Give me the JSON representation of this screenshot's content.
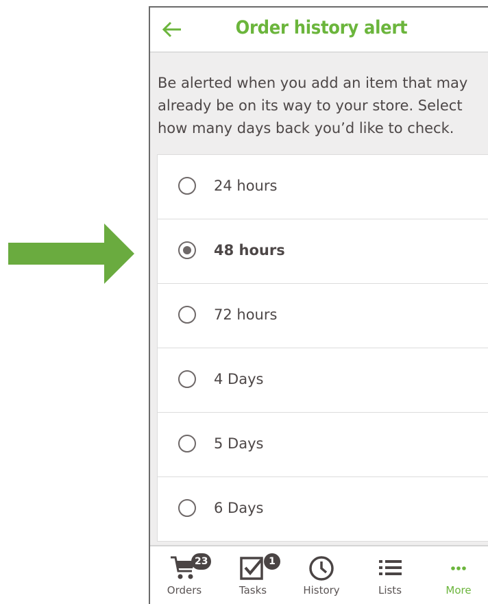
{
  "header": {
    "title": "Order history alert",
    "back_icon": "arrow-left-icon"
  },
  "description": "Be alerted when you add an item that may already be on its way to your store. Select how many days back you’d like to check.",
  "options": [
    {
      "label": "24 hours",
      "selected": false
    },
    {
      "label": "48 hours",
      "selected": true
    },
    {
      "label": "72 hours",
      "selected": false
    },
    {
      "label": "4 Days",
      "selected": false
    },
    {
      "label": "5 Days",
      "selected": false
    },
    {
      "label": "6 Days",
      "selected": false
    }
  ],
  "tabs": [
    {
      "label": "Orders",
      "icon": "cart-icon",
      "badge": "23"
    },
    {
      "label": "Tasks",
      "icon": "checkbox-icon",
      "badge": "1"
    },
    {
      "label": "History",
      "icon": "clock-icon"
    },
    {
      "label": "Lists",
      "icon": "list-icon"
    },
    {
      "label": "More",
      "icon": "more-icon",
      "active": true
    }
  ],
  "colors": {
    "accent": "#6bb53c",
    "text": "#4a4444",
    "background": "#efeeee"
  }
}
